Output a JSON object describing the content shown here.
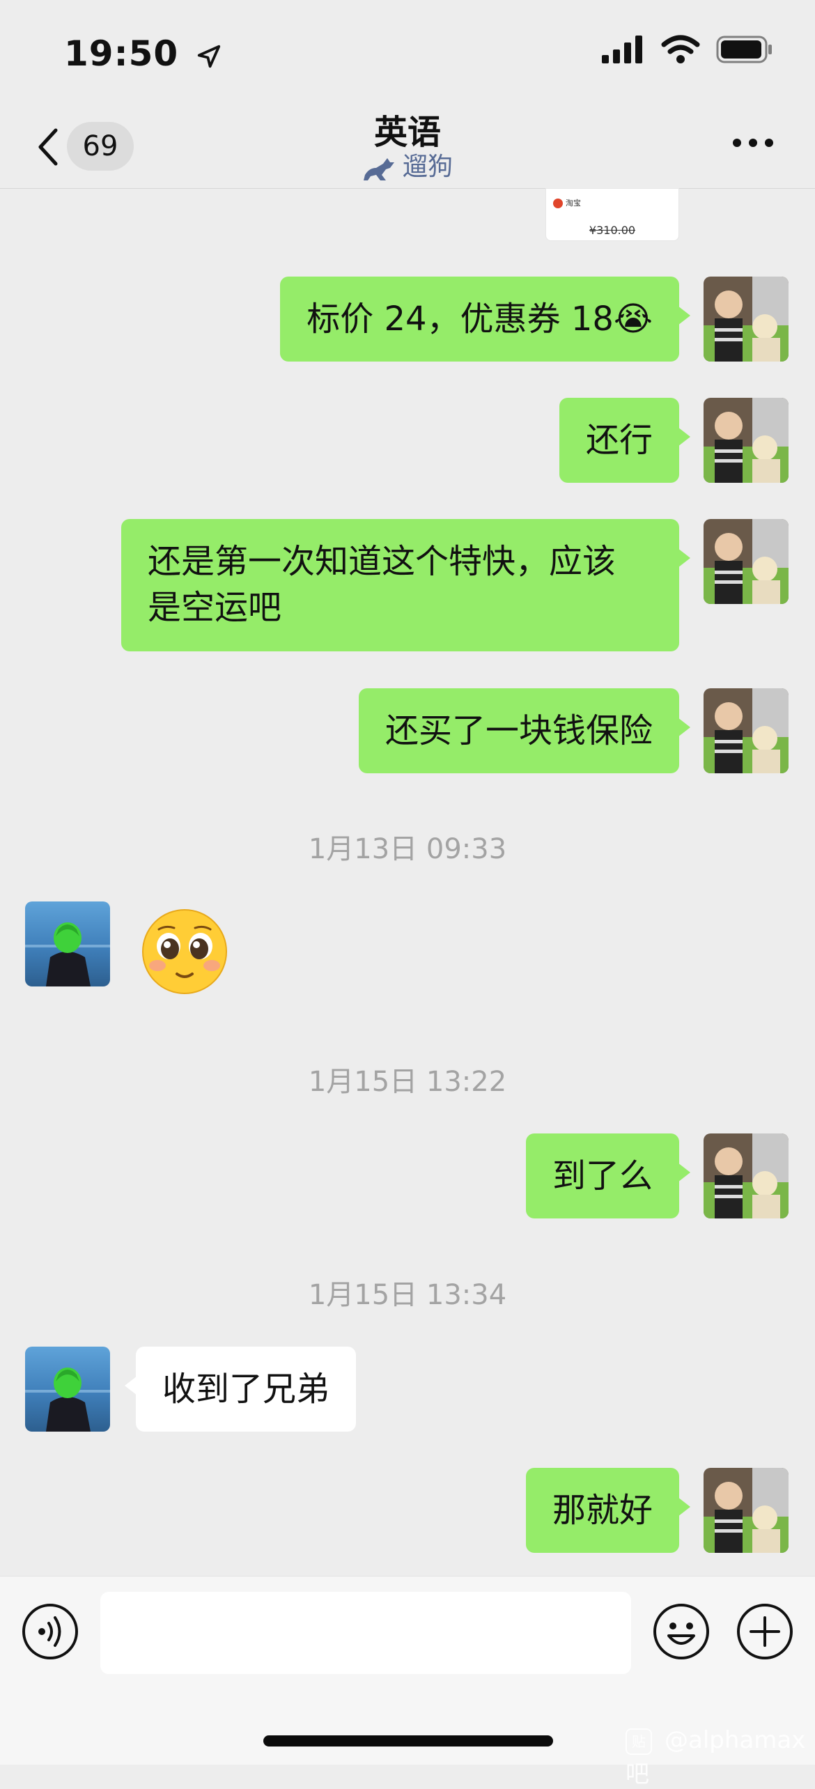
{
  "status_bar": {
    "time": "19:50"
  },
  "nav": {
    "unread_count": "69",
    "title": "英语",
    "subtitle": "遛狗"
  },
  "messages": [
    {
      "side": "me",
      "text": "标价 24，优惠券 18😭"
    },
    {
      "side": "me",
      "text": "还行"
    },
    {
      "side": "me",
      "text": "还是第一次知道这个特快，应该\n是空运吧"
    },
    {
      "side": "me",
      "text": "还买了一块钱保险"
    },
    {
      "timestamp": "1月13日 09:33"
    },
    {
      "side": "other",
      "sticker": "pleading-face-emoji"
    },
    {
      "timestamp": "1月15日 13:22"
    },
    {
      "side": "me",
      "text": "到了么"
    },
    {
      "timestamp": "1月15日 13:34"
    },
    {
      "side": "other",
      "text": "收到了兄弟"
    },
    {
      "side": "me",
      "text": "那就好"
    }
  ],
  "image_card": {
    "app": "淘宝",
    "price": "¥310.00"
  },
  "input": {
    "value": ""
  },
  "watermark": "@alphamax吧",
  "colors": {
    "my_bubble": "#95ec69",
    "other_bubble": "#ffffff",
    "background": "#ededed",
    "subtitle": "#576b95"
  }
}
